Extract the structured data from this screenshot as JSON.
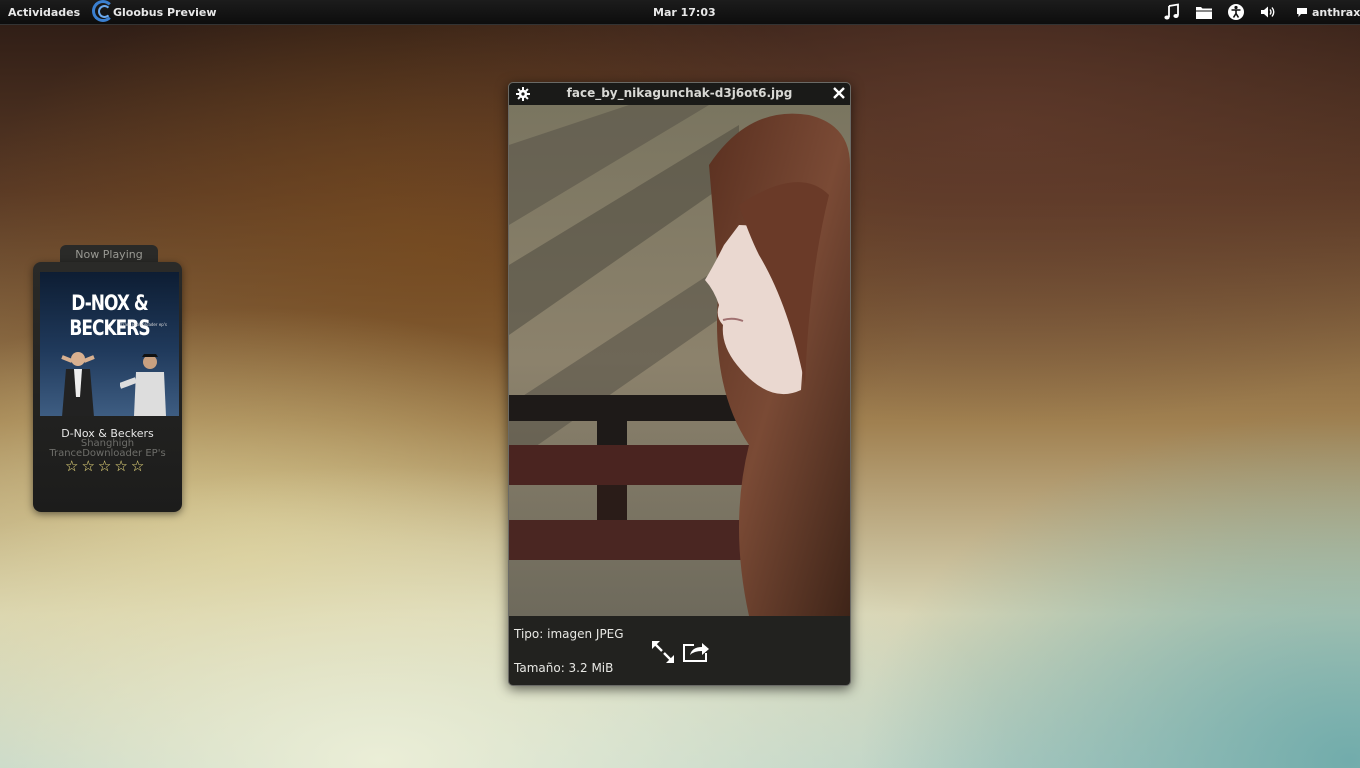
{
  "top_panel": {
    "activities_label": "Actividades",
    "app_name": "Gloobus Preview",
    "clock": "Mar 17:03",
    "indicators": [
      "music-icon",
      "folder-icon",
      "accessibility-icon",
      "volume-icon",
      "chat-icon"
    ],
    "user_name": "anthrax"
  },
  "now_playing": {
    "tab_label": "Now Playing",
    "album_art_text": "D-NOX & BECKERS",
    "album_art_subtext": "trancedownloader ep's",
    "artist": "D-Nox & Beckers",
    "track": "Shanghigh",
    "album": "TranceDownloader EP's",
    "rating": 0,
    "rating_max": 5
  },
  "preview_window": {
    "title": "face_by_nikagunchak-d3j6ot6.jpg",
    "type_label": "Tipo: imagen JPEG",
    "size_label": "Tamaño: 3.2 MiB",
    "buttons": [
      "fullscreen-icon",
      "open-external-icon"
    ]
  },
  "colors": {
    "panel_bg": "#111111",
    "accent_blue": "#3a7fd0",
    "star_color": "#f0e080",
    "window_bg": "#22221f"
  }
}
